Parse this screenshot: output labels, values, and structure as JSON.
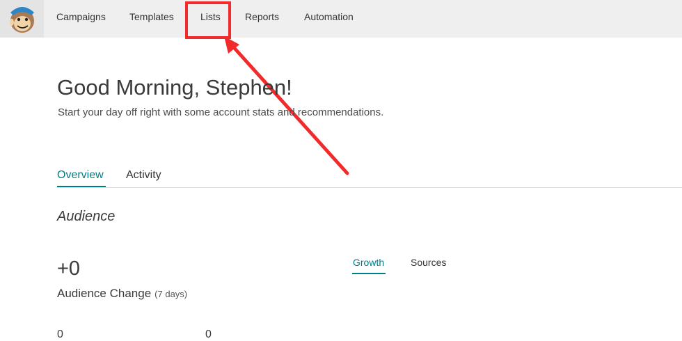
{
  "nav": {
    "items": [
      {
        "label": "Campaigns"
      },
      {
        "label": "Templates"
      },
      {
        "label": "Lists"
      },
      {
        "label": "Reports"
      },
      {
        "label": "Automation"
      }
    ]
  },
  "header": {
    "greeting": "Good Morning, Stephen!",
    "subtitle": "Start your day off right with some account stats and recommendations."
  },
  "tabs": [
    {
      "label": "Overview",
      "active": true
    },
    {
      "label": "Activity",
      "active": false
    }
  ],
  "audience": {
    "title": "Audience",
    "change_value": "+0",
    "change_label": "Audience Change",
    "change_period": "(7 days)",
    "subtabs": [
      {
        "label": "Growth",
        "active": true
      },
      {
        "label": "Sources",
        "active": false
      }
    ],
    "stats": [
      {
        "value": "0"
      },
      {
        "value": "0"
      }
    ]
  },
  "colors": {
    "accent": "#007c89",
    "annotation": "#f12b2b"
  }
}
